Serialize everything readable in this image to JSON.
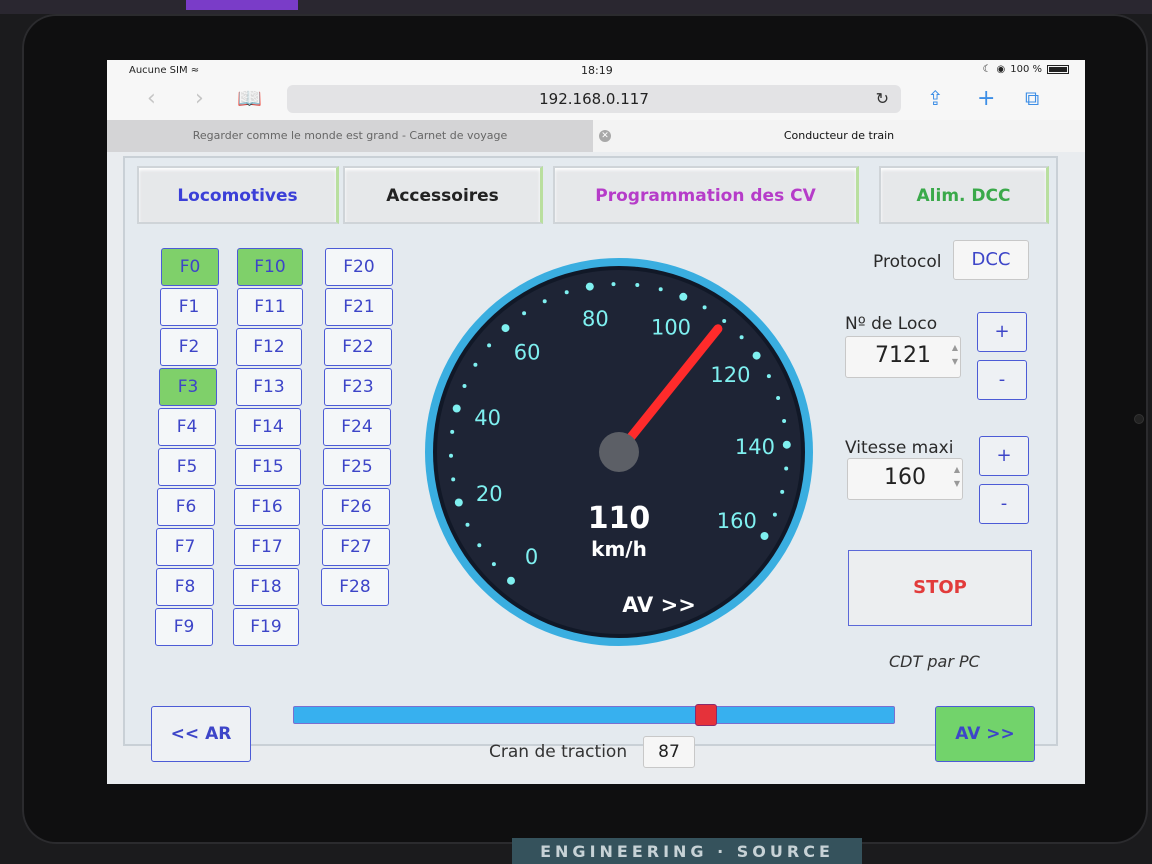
{
  "statusbar": {
    "carrier": "Aucune SIM",
    "time": "18:19",
    "battery": "100 %"
  },
  "browser": {
    "url": "192.168.0.117",
    "tabs": [
      {
        "title": "Regarder comme le monde est grand - Carnet de voyage",
        "active": false
      },
      {
        "title": "Conducteur de train",
        "active": true
      }
    ]
  },
  "nav": {
    "tabs": [
      {
        "label": "Locomotives",
        "color": "#3b3fd8"
      },
      {
        "label": "Accessoires",
        "color": "#222222"
      },
      {
        "label": "Programmation des CV",
        "color": "#b63cc9"
      },
      {
        "label": "Alim. DCC",
        "color": "#3aa94a"
      }
    ]
  },
  "functions": {
    "col1": [
      "F0",
      "F1",
      "F2",
      "F3",
      "F4",
      "F5",
      "F6",
      "F7",
      "F8",
      "F9"
    ],
    "col2": [
      "F10",
      "F11",
      "F12",
      "F13",
      "F14",
      "F15",
      "F16",
      "F17",
      "F18",
      "F19"
    ],
    "col3": [
      "F20",
      "F21",
      "F22",
      "F23",
      "F24",
      "F25",
      "F26",
      "F27",
      "F28"
    ],
    "active": [
      "F0",
      "F10",
      "F3"
    ]
  },
  "gauge": {
    "speed": "110",
    "unit": "km/h",
    "direction": "AV >>",
    "max": 160,
    "needle_value": 110,
    "scale_labels": [
      "0",
      "20",
      "40",
      "60",
      "80",
      "100",
      "120",
      "140",
      "160"
    ],
    "accent": "#7ff0f0",
    "needle_color": "#ff2b2b",
    "ring_color": "#3aaee0"
  },
  "controls": {
    "protocol_label": "Protocol",
    "protocol_value": "DCC",
    "loco_label": "Nº de Loco",
    "loco_value": "7121",
    "vmax_label": "Vitesse maxi",
    "vmax_value": "160",
    "plus": "+",
    "minus": "-",
    "stop": "STOP",
    "cdt": "CDT par PC"
  },
  "traction": {
    "ar_label": "<< AR",
    "av_label": "AV >>",
    "cran_label": "Cran de traction",
    "cran_value": "87",
    "slider_fraction": 0.687
  },
  "sticker": "ENGINEERING · SOURCE"
}
